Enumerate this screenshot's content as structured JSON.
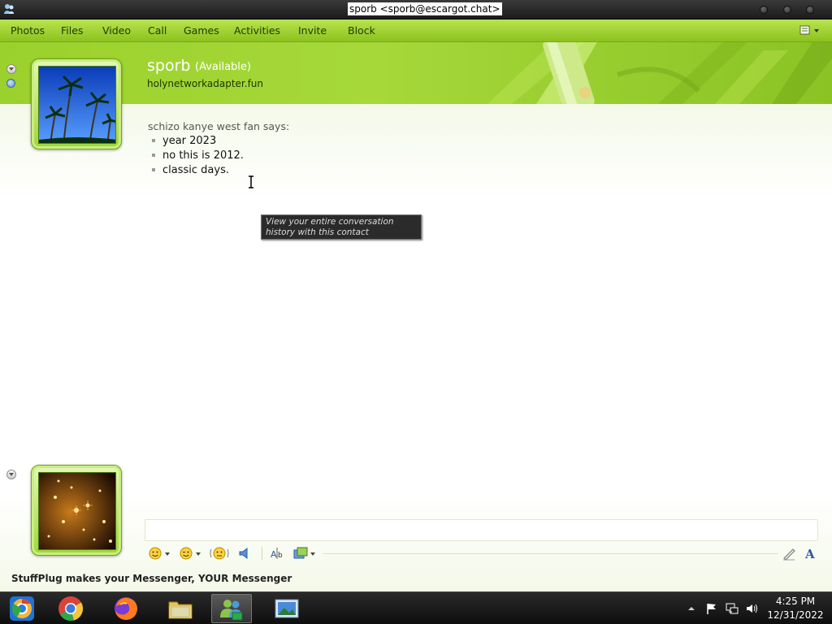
{
  "window": {
    "title": "sporb <sporb@escargot.chat>"
  },
  "menu": {
    "items": [
      "Photos",
      "Files",
      "Video",
      "Call",
      "Games",
      "Activities",
      "Invite",
      "Block"
    ]
  },
  "contact": {
    "name": "sporb",
    "status": "(Available)",
    "personal_message": "holynetworkadapter.fun"
  },
  "conversation": {
    "sender_line": "schizo kanye west fan says:",
    "messages": [
      "year 2023",
      "no this is 2012.",
      "classic days."
    ]
  },
  "tooltip": {
    "text": "View your entire conversation history with this contact"
  },
  "input": {
    "value": ""
  },
  "toolbar_icons": [
    "emoticon-icon",
    "wink-icon",
    "nudge-icon",
    "voice-clip-icon",
    "font-icon",
    "background-icon",
    "handwriting-icon",
    "text-style-icon"
  ],
  "footer": {
    "text": "StuffPlug makes your Messenger, YOUR Messenger"
  },
  "taskbar": {
    "apps": [
      "chrome-canary-icon",
      "chrome-icon",
      "firefox-icon",
      "file-explorer-icon",
      "messenger-icon",
      "photo-viewer-icon"
    ],
    "active_app": "messenger-icon",
    "clock_time": "4:25 PM",
    "clock_date": "12/31/2022"
  },
  "colors": {
    "theme_green": "#9bd12c",
    "menu_text": "#1f3a06",
    "taskbar": "#1a1a1a"
  }
}
